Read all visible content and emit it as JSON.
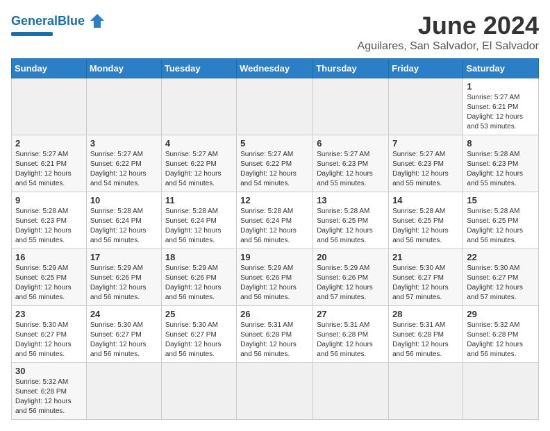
{
  "header": {
    "logo_general": "General",
    "logo_blue": "Blue",
    "month_title": "June 2024",
    "subtitle": "Aguilares, San Salvador, El Salvador"
  },
  "days_of_week": [
    "Sunday",
    "Monday",
    "Tuesday",
    "Wednesday",
    "Thursday",
    "Friday",
    "Saturday"
  ],
  "weeks": [
    [
      {
        "day": "",
        "info": ""
      },
      {
        "day": "",
        "info": ""
      },
      {
        "day": "",
        "info": ""
      },
      {
        "day": "",
        "info": ""
      },
      {
        "day": "",
        "info": ""
      },
      {
        "day": "",
        "info": ""
      },
      {
        "day": "1",
        "info": "Sunrise: 5:27 AM\nSunset: 6:21 PM\nDaylight: 12 hours\nand 53 minutes."
      }
    ],
    [
      {
        "day": "2",
        "info": "Sunrise: 5:27 AM\nSunset: 6:21 PM\nDaylight: 12 hours\nand 54 minutes."
      },
      {
        "day": "3",
        "info": "Sunrise: 5:27 AM\nSunset: 6:22 PM\nDaylight: 12 hours\nand 54 minutes."
      },
      {
        "day": "4",
        "info": "Sunrise: 5:27 AM\nSunset: 6:22 PM\nDaylight: 12 hours\nand 54 minutes."
      },
      {
        "day": "5",
        "info": "Sunrise: 5:27 AM\nSunset: 6:22 PM\nDaylight: 12 hours\nand 54 minutes."
      },
      {
        "day": "6",
        "info": "Sunrise: 5:27 AM\nSunset: 6:23 PM\nDaylight: 12 hours\nand 55 minutes."
      },
      {
        "day": "7",
        "info": "Sunrise: 5:27 AM\nSunset: 6:23 PM\nDaylight: 12 hours\nand 55 minutes."
      },
      {
        "day": "8",
        "info": "Sunrise: 5:28 AM\nSunset: 6:23 PM\nDaylight: 12 hours\nand 55 minutes."
      }
    ],
    [
      {
        "day": "9",
        "info": "Sunrise: 5:28 AM\nSunset: 6:23 PM\nDaylight: 12 hours\nand 55 minutes."
      },
      {
        "day": "10",
        "info": "Sunrise: 5:28 AM\nSunset: 6:24 PM\nDaylight: 12 hours\nand 56 minutes."
      },
      {
        "day": "11",
        "info": "Sunrise: 5:28 AM\nSunset: 6:24 PM\nDaylight: 12 hours\nand 56 minutes."
      },
      {
        "day": "12",
        "info": "Sunrise: 5:28 AM\nSunset: 6:24 PM\nDaylight: 12 hours\nand 56 minutes."
      },
      {
        "day": "13",
        "info": "Sunrise: 5:28 AM\nSunset: 6:25 PM\nDaylight: 12 hours\nand 56 minutes."
      },
      {
        "day": "14",
        "info": "Sunrise: 5:28 AM\nSunset: 6:25 PM\nDaylight: 12 hours\nand 56 minutes."
      },
      {
        "day": "15",
        "info": "Sunrise: 5:28 AM\nSunset: 6:25 PM\nDaylight: 12 hours\nand 56 minutes."
      }
    ],
    [
      {
        "day": "16",
        "info": "Sunrise: 5:29 AM\nSunset: 6:25 PM\nDaylight: 12 hours\nand 56 minutes."
      },
      {
        "day": "17",
        "info": "Sunrise: 5:29 AM\nSunset: 6:26 PM\nDaylight: 12 hours\nand 56 minutes."
      },
      {
        "day": "18",
        "info": "Sunrise: 5:29 AM\nSunset: 6:26 PM\nDaylight: 12 hours\nand 56 minutes."
      },
      {
        "day": "19",
        "info": "Sunrise: 5:29 AM\nSunset: 6:26 PM\nDaylight: 12 hours\nand 56 minutes."
      },
      {
        "day": "20",
        "info": "Sunrise: 5:29 AM\nSunset: 6:26 PM\nDaylight: 12 hours\nand 57 minutes."
      },
      {
        "day": "21",
        "info": "Sunrise: 5:30 AM\nSunset: 6:27 PM\nDaylight: 12 hours\nand 57 minutes."
      },
      {
        "day": "22",
        "info": "Sunrise: 5:30 AM\nSunset: 6:27 PM\nDaylight: 12 hours\nand 57 minutes."
      }
    ],
    [
      {
        "day": "23",
        "info": "Sunrise: 5:30 AM\nSunset: 6:27 PM\nDaylight: 12 hours\nand 56 minutes."
      },
      {
        "day": "24",
        "info": "Sunrise: 5:30 AM\nSunset: 6:27 PM\nDaylight: 12 hours\nand 56 minutes."
      },
      {
        "day": "25",
        "info": "Sunrise: 5:30 AM\nSunset: 6:27 PM\nDaylight: 12 hours\nand 56 minutes."
      },
      {
        "day": "26",
        "info": "Sunrise: 5:31 AM\nSunset: 6:28 PM\nDaylight: 12 hours\nand 56 minutes."
      },
      {
        "day": "27",
        "info": "Sunrise: 5:31 AM\nSunset: 6:28 PM\nDaylight: 12 hours\nand 56 minutes."
      },
      {
        "day": "28",
        "info": "Sunrise: 5:31 AM\nSunset: 6:28 PM\nDaylight: 12 hours\nand 56 minutes."
      },
      {
        "day": "29",
        "info": "Sunrise: 5:32 AM\nSunset: 6:28 PM\nDaylight: 12 hours\nand 56 minutes."
      }
    ],
    [
      {
        "day": "30",
        "info": "Sunrise: 5:32 AM\nSunset: 6:28 PM\nDaylight: 12 hours\nand 56 minutes."
      },
      {
        "day": "",
        "info": ""
      },
      {
        "day": "",
        "info": ""
      },
      {
        "day": "",
        "info": ""
      },
      {
        "day": "",
        "info": ""
      },
      {
        "day": "",
        "info": ""
      },
      {
        "day": "",
        "info": ""
      }
    ]
  ]
}
